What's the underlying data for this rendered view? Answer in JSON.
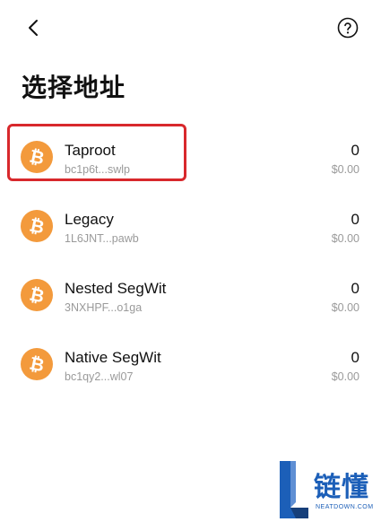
{
  "header": {
    "back_icon": "chevron-left-icon",
    "help_icon": "question-circle-icon"
  },
  "title": "选择地址",
  "coin_icon_symbol": "₿",
  "coin_color": "#f39a3c",
  "highlight_color": "#d8282c",
  "addresses": [
    {
      "type": "Taproot",
      "address": "bc1p6t...swlp",
      "balance": "0",
      "fiat": "$0.00"
    },
    {
      "type": "Legacy",
      "address": "1L6JNT...pawb",
      "balance": "0",
      "fiat": "$0.00"
    },
    {
      "type": "Nested SegWit",
      "address": "3NXHPF...o1ga",
      "balance": "0",
      "fiat": "$0.00"
    },
    {
      "type": "Native SegWit",
      "address": "bc1qy2...wl07",
      "balance": "0",
      "fiat": "$0.00"
    }
  ],
  "watermark": {
    "chars": "链懂",
    "domain": "NEATDOWN.COM"
  }
}
